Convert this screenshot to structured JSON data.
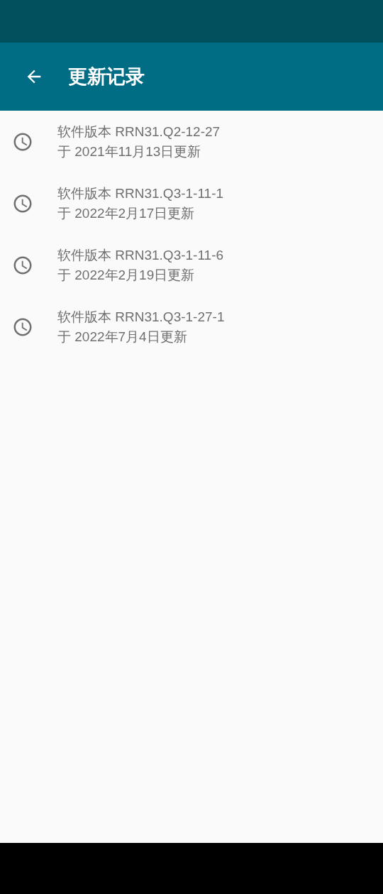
{
  "app_bar": {
    "title": "更新记录"
  },
  "updates": [
    {
      "version": "软件版本 RRN31.Q2-12-27",
      "date": "于 2021年11月13日更新"
    },
    {
      "version": "软件版本 RRN31.Q3-1-11-1",
      "date": "于 2022年2月17日更新"
    },
    {
      "version": "软件版本 RRN31.Q3-1-11-6",
      "date": "于 2022年2月19日更新"
    },
    {
      "version": "软件版本 RRN31.Q3-1-27-1",
      "date": "于 2022年7月4日更新"
    }
  ]
}
